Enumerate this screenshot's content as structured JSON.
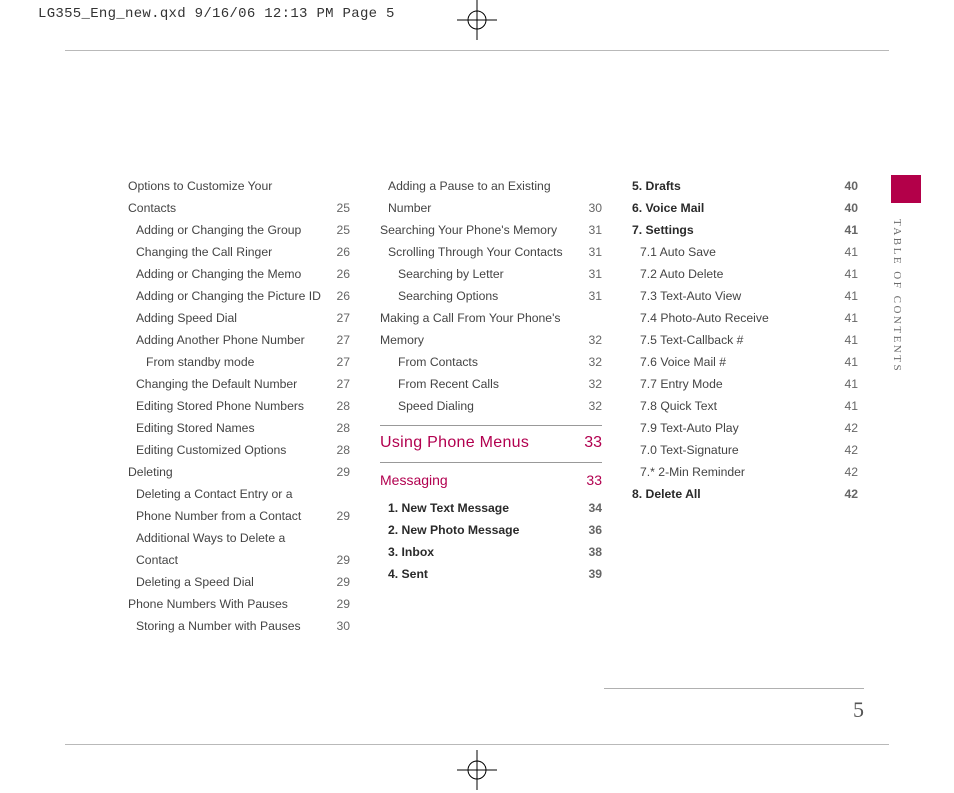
{
  "slug": "LG355_Eng_new.qxd  9/16/06  12:13 PM  Page 5",
  "side_label": "TABLE OF CONTENTS",
  "page_number": "5",
  "col1": [
    {
      "t": "Options to Customize Your Contacts",
      "p": "25",
      "lvl": 1
    },
    {
      "t": "Adding or Changing the Group",
      "p": "25",
      "lvl": 2
    },
    {
      "t": "Changing the Call Ringer",
      "p": "26",
      "lvl": 2
    },
    {
      "t": "Adding or Changing the Memo",
      "p": "26",
      "lvl": 2
    },
    {
      "t": "Adding or Changing the Picture ID",
      "p": "26",
      "lvl": 2
    },
    {
      "t": "Adding Speed Dial",
      "p": "27",
      "lvl": 2
    },
    {
      "t": "Adding Another Phone Number",
      "p": "27",
      "lvl": 2
    },
    {
      "t": "From standby mode",
      "p": "27",
      "lvl": 3
    },
    {
      "t": "Changing the Default Number",
      "p": "27",
      "lvl": 2
    },
    {
      "t": "Editing Stored Phone Numbers",
      "p": "28",
      "lvl": 2
    },
    {
      "t": "Editing Stored Names",
      "p": "28",
      "lvl": 2
    },
    {
      "t": "Editing Customized Options",
      "p": "28",
      "lvl": 2
    },
    {
      "t": "Deleting",
      "p": "29",
      "lvl": 1
    },
    {
      "t": "Deleting a Contact Entry or a Phone Number from a Contact",
      "p": "29",
      "lvl": 2
    },
    {
      "t": "Additional Ways to Delete a Contact",
      "p": "29",
      "lvl": 2
    },
    {
      "t": "Deleting a Speed Dial",
      "p": "29",
      "lvl": 2
    },
    {
      "t": "Phone Numbers With Pauses",
      "p": "29",
      "lvl": 1
    },
    {
      "t": "Storing a Number with Pauses",
      "p": "30",
      "lvl": 2
    }
  ],
  "col2_top": [
    {
      "t": "Adding a Pause to an Existing Number",
      "p": "30",
      "lvl": 2
    },
    {
      "t": "Searching Your Phone's Memory",
      "p": "31",
      "lvl": 1
    },
    {
      "t": "Scrolling Through Your Contacts",
      "p": "31",
      "lvl": 2
    },
    {
      "t": "Searching by Letter",
      "p": "31",
      "lvl": 3
    },
    {
      "t": "Searching Options",
      "p": "31",
      "lvl": 3
    },
    {
      "t": "Making a Call From Your Phone's Memory",
      "p": "32",
      "lvl": 1
    },
    {
      "t": "From Contacts",
      "p": "32",
      "lvl": 3
    },
    {
      "t": "From Recent Calls",
      "p": "32",
      "lvl": 3
    },
    {
      "t": "Speed Dialing",
      "p": "32",
      "lvl": 3
    }
  ],
  "section1": {
    "t": "Using Phone Menus",
    "p": "33"
  },
  "section2": {
    "t": "Messaging",
    "p": "33"
  },
  "col2_msg": [
    {
      "t": "1. New Text Message",
      "p": "34",
      "bold": true
    },
    {
      "t": "2. New Photo Message",
      "p": "36",
      "bold": true
    },
    {
      "t": "3. Inbox",
      "p": "38",
      "bold": true
    },
    {
      "t": "4. Sent",
      "p": "39",
      "bold": true
    }
  ],
  "col3": [
    {
      "t": "5. Drafts",
      "p": "40",
      "bold": true
    },
    {
      "t": "6. Voice Mail",
      "p": "40",
      "bold": true
    },
    {
      "t": "7. Settings",
      "p": "41",
      "bold": true
    },
    {
      "t": "7.1 Auto Save",
      "p": "41",
      "lvl": 2
    },
    {
      "t": "7.2 Auto Delete",
      "p": "41",
      "lvl": 2
    },
    {
      "t": "7.3 Text-Auto View",
      "p": "41",
      "lvl": 2
    },
    {
      "t": "7.4 Photo-Auto Receive",
      "p": "41",
      "lvl": 2
    },
    {
      "t": "7.5 Text-Callback #",
      "p": "41",
      "lvl": 2
    },
    {
      "t": "7.6 Voice Mail #",
      "p": "41",
      "lvl": 2
    },
    {
      "t": "7.7 Entry Mode",
      "p": "41",
      "lvl": 2
    },
    {
      "t": "7.8 Quick Text",
      "p": "41",
      "lvl": 2
    },
    {
      "t": "7.9 Text-Auto Play",
      "p": "42",
      "lvl": 2
    },
    {
      "t": "7.0 Text-Signature",
      "p": "42",
      "lvl": 2
    },
    {
      "t": "7.* 2-Min Reminder",
      "p": "42",
      "lvl": 2
    },
    {
      "t": "8. Delete All",
      "p": "42",
      "bold": true
    }
  ]
}
